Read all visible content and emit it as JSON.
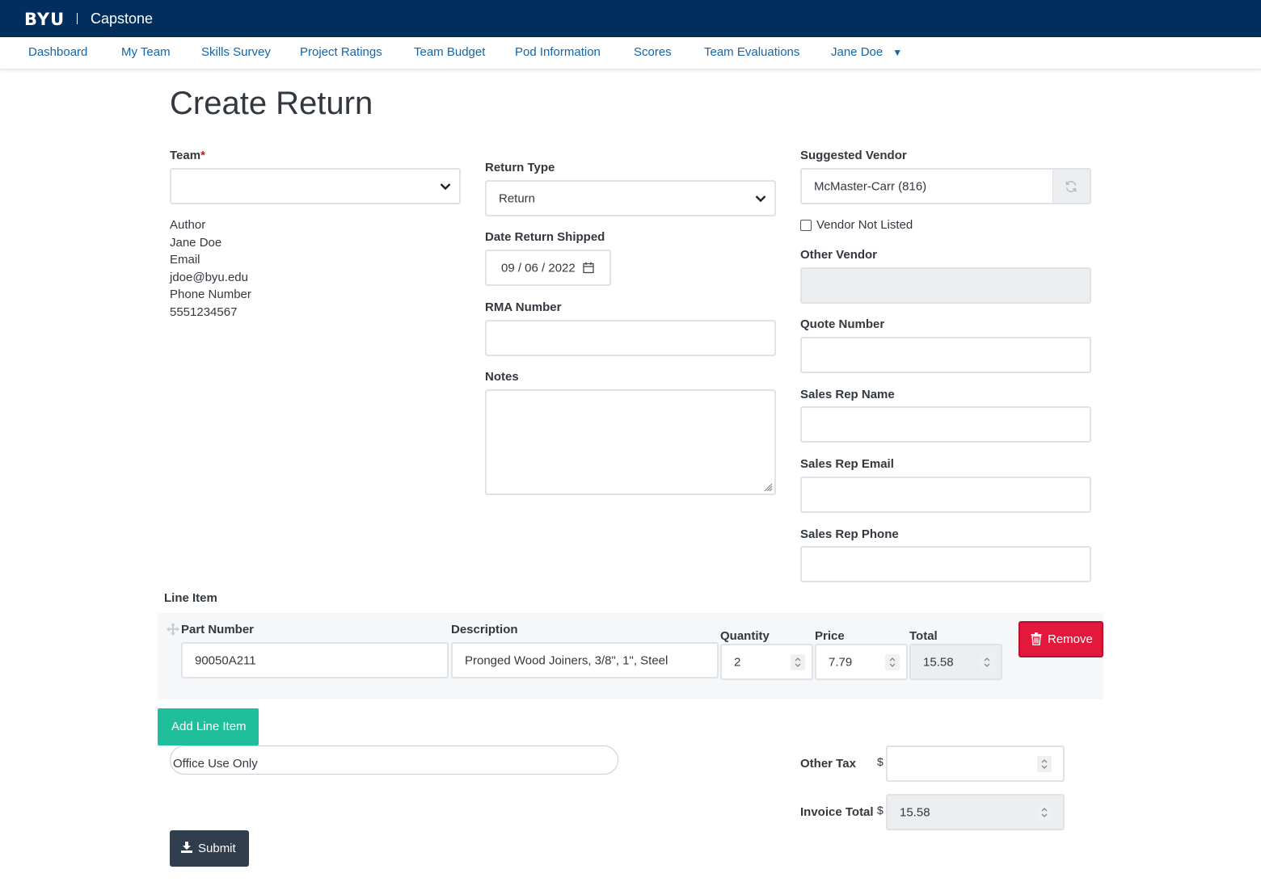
{
  "brand": {
    "logo": "BYU",
    "app_name": "Capstone"
  },
  "nav": {
    "items": [
      "Dashboard",
      "My Team",
      "Skills Survey",
      "Project Ratings",
      "Team Budget",
      "Pod Information",
      "Scores",
      "Team Evaluations"
    ],
    "user": "Jane Doe"
  },
  "page": {
    "title": "Create Return"
  },
  "form": {
    "team": {
      "label": "Team",
      "required_mark": "*",
      "value": ""
    },
    "author": {
      "author_label": "Author",
      "author_value": "Jane Doe",
      "email_label": "Email",
      "email_value": "jdoe@byu.edu",
      "phone_label": "Phone Number",
      "phone_value": "5551234567"
    },
    "return_type": {
      "label": "Return Type",
      "value": "Return"
    },
    "date_shipped": {
      "label": "Date Return Shipped",
      "value": "09 / 06 / 2022"
    },
    "rma_number": {
      "label": "RMA Number",
      "value": ""
    },
    "notes": {
      "label": "Notes",
      "value": ""
    },
    "suggested_vendor": {
      "label": "Suggested Vendor",
      "value": "McMaster-Carr (816)"
    },
    "vendor_not_listed": {
      "label": "Vendor Not Listed",
      "checked": false
    },
    "other_vendor": {
      "label": "Other Vendor",
      "value": ""
    },
    "quote_number": {
      "label": "Quote Number",
      "value": ""
    },
    "sales_rep_name": {
      "label": "Sales Rep Name",
      "value": ""
    },
    "sales_rep_email": {
      "label": "Sales Rep Email",
      "value": ""
    },
    "sales_rep_phone": {
      "label": "Sales Rep Phone",
      "value": ""
    }
  },
  "line_items": {
    "section_label": "Line Item",
    "headers": {
      "part_number": "Part Number",
      "description": "Description",
      "quantity": "Quantity",
      "price": "Price",
      "total": "Total"
    },
    "rows": [
      {
        "part_number": "90050A211",
        "description": "Pronged Wood Joiners, 3/8\", 1\", Steel",
        "quantity": "2",
        "price": "7.79",
        "total": "15.58"
      }
    ],
    "remove_label": "Remove",
    "add_label": "Add Line Item"
  },
  "office_use": {
    "label": "Office Use Only"
  },
  "totals": {
    "other_tax_label": "Other Tax",
    "other_tax_value": "",
    "invoice_total_label": "Invoice Total",
    "invoice_total_value": "15.58",
    "currency": "$"
  },
  "submit_label": "Submit",
  "colors": {
    "header_bg": "#002e5d",
    "nav_link": "#1565a7",
    "remove": "#e2183c",
    "add": "#1fbf9b",
    "submit": "#2f3d4c"
  }
}
